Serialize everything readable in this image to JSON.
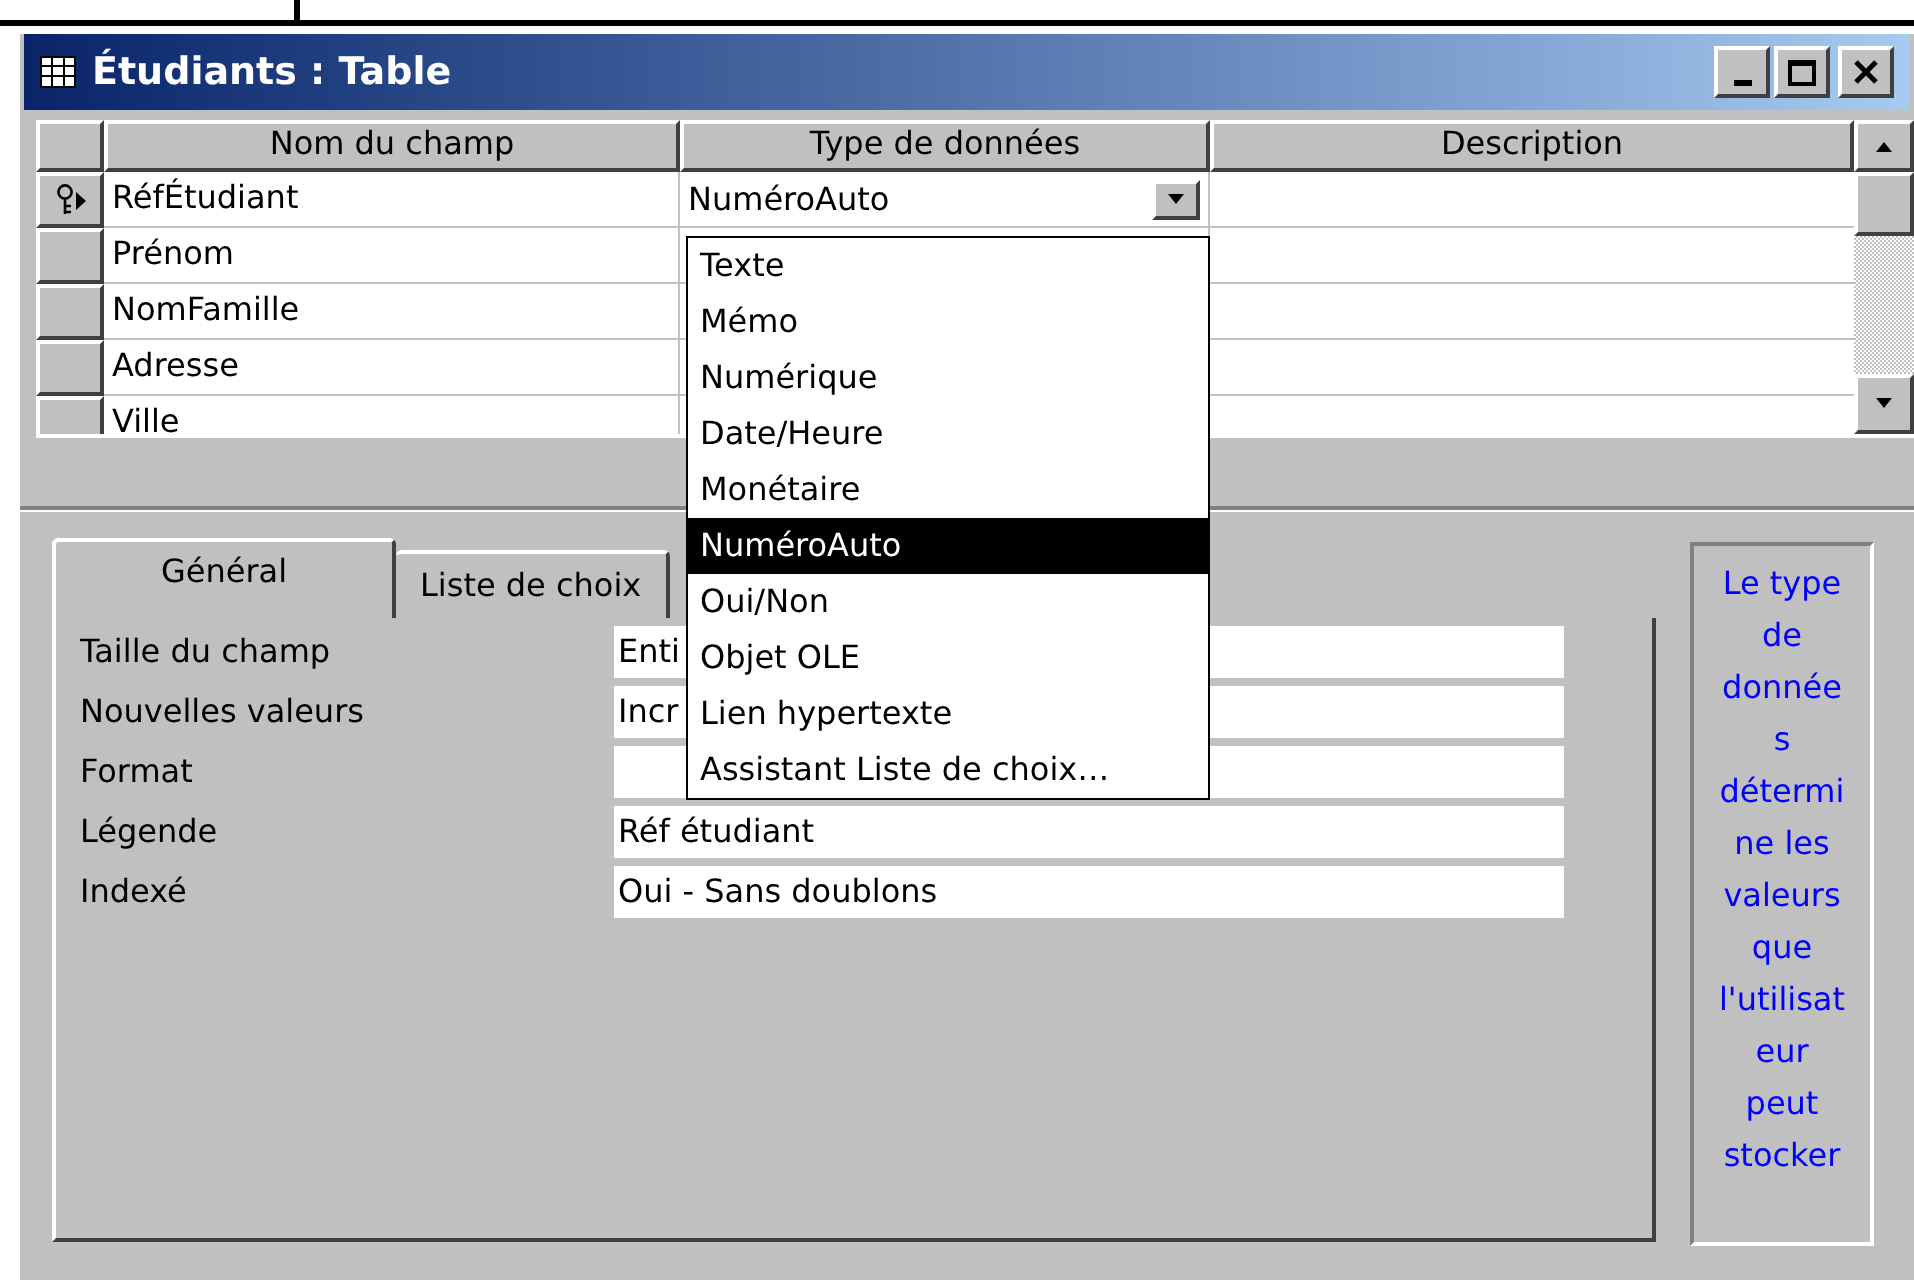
{
  "window": {
    "title": "Étudiants : Table"
  },
  "grid": {
    "columns": [
      "Nom du champ",
      "Type de données",
      "Description"
    ],
    "rows": [
      {
        "name": "RéfÉtudiant",
        "type": "NuméroAuto",
        "primary_key": true,
        "current": true
      },
      {
        "name": "Prénom",
        "primary_key": false,
        "current": false
      },
      {
        "name": "NomFamille",
        "primary_key": false,
        "current": false
      },
      {
        "name": "Adresse",
        "primary_key": false,
        "current": false
      },
      {
        "name": "Ville",
        "primary_key": false,
        "current": false
      }
    ]
  },
  "dropdown": {
    "options": [
      {
        "label": "Texte",
        "selected": false
      },
      {
        "label": "Mémo",
        "selected": false
      },
      {
        "label": "Numérique",
        "selected": false
      },
      {
        "label": "Date/Heure",
        "selected": false
      },
      {
        "label": "Monétaire",
        "selected": false
      },
      {
        "label": "NuméroAuto",
        "selected": true
      },
      {
        "label": "Oui/Non",
        "selected": false
      },
      {
        "label": "Objet OLE",
        "selected": false
      },
      {
        "label": "Lien hypertexte",
        "selected": false
      },
      {
        "label": "Assistant Liste de choix…",
        "selected": false
      }
    ]
  },
  "tabs": [
    {
      "label": "Général",
      "selected": true
    },
    {
      "label": "Liste de choix",
      "selected": false
    }
  ],
  "properties": [
    {
      "label": "Taille du champ",
      "value": "Enti"
    },
    {
      "label": "Nouvelles valeurs",
      "value": "Incr"
    },
    {
      "label": "Format"
    },
    {
      "label": "Légende",
      "value": "Réf étudiant"
    },
    {
      "label": "Indexé",
      "value": "Oui - Sans doublons"
    }
  ],
  "help": "Le type de données détermine les valeurs que l'utilisateur peut stocker"
}
